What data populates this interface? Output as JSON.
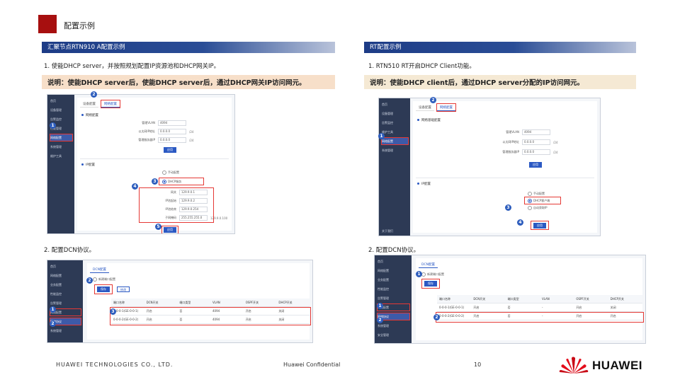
{
  "page": {
    "title": "配置示例",
    "page_number": "10",
    "footer_left": "HUAWEI TECHNOLOGIES CO., LTD.",
    "footer_center": "Huawei Confidential",
    "logo_text": "HUAWEI",
    "brand_color": "#a70f0f"
  },
  "left_panel": {
    "banner": "汇聚节点RTN910 A配置示例",
    "step1": "1. 使能DHCP server，并按照规划配置IP资源池和DHCP网关IP。",
    "note": "说明：使能DHCP server后，使能DHCP server后，通过DHCP网关IP访问网元。",
    "step2": "2. 配置DCN协议。",
    "shot1": {
      "sidebar": [
        "首页",
        "设备管理",
        "告警监控",
        "性能管理",
        "网络配置",
        "系统管理",
        "维护工具"
      ],
      "tabs": [
        "设备配置",
        "网络配置"
      ],
      "sec1": "网络配置",
      "fields": [
        {
          "label": "管理VLAN",
          "value": "4094",
          "unit": ""
        },
        {
          "label": "以太网IP地址",
          "value": "0.0.0.0",
          "unit": "/24"
        },
        {
          "label": "管理服务器IP",
          "value": "0.0.0.0",
          "unit": "/24"
        }
      ],
      "apply": "应用",
      "sec2": "IP配置",
      "radios": [
        "手动配置",
        "DHCP服务"
      ],
      "pool_fields": [
        {
          "label": "网关",
          "value": "129.9.0.1"
        },
        {
          "label": "IP池起始",
          "value": "129.9.0.2"
        },
        {
          "label": "IP池结束",
          "value": "129.9.0.254"
        },
        {
          "label": "子网掩码",
          "value": "255.255.255.0"
        }
      ],
      "range": "129.9.0.100",
      "save": "应用"
    },
    "shot2": {
      "sidebar": [
        "首页",
        "网络配置",
        "业务配置",
        "性能监控",
        "告警管理",
        "网络配置",
        "网络协议",
        "系统管理"
      ],
      "tab": "DCN配置",
      "toolbar": "新建端口配置",
      "btn1": "保存",
      "btn2": "修改",
      "columns": [
        "端口名称",
        "DCN开关",
        "端口类型",
        "VLAN",
        "OSPF开关",
        "DHCP开关"
      ],
      "rows": [
        [
          "0-0-0-1(GE-0-0-1)",
          "开启",
          "否",
          "4094",
          "开启",
          "关闭"
        ],
        [
          "0-0-0-2(GE-0-0-2)",
          "开启",
          "否",
          "4094",
          "开启",
          "关闭"
        ]
      ]
    }
  },
  "right_panel": {
    "banner": "RT配置示例",
    "step1": "1. RTN510 RT开启DHCP Client功能。",
    "note": "说明：使能DHCP client后，通过DHCP server分配的IP访问网元。",
    "step2": "2. 配置DCN协议。",
    "shot1": {
      "sidebar": [
        "首页",
        "设备管理",
        "告警监控",
        "维护工具",
        "网络配置",
        "系统管理"
      ],
      "bottom_item": "关于我们",
      "tabs": [
        "设备配置",
        "网络配置"
      ],
      "sec1": "网络基础配置",
      "fields": [
        {
          "label": "管理VLAN",
          "value": "4094",
          "unit": ""
        },
        {
          "label": "以太网IP地址",
          "value": "0.0.0.0",
          "unit": "/24"
        },
        {
          "label": "管理服务器IP",
          "value": "0.0.0.0",
          "unit": "/24"
        }
      ],
      "apply": "应用",
      "sec2": "IP配置",
      "radios": [
        "手动配置",
        "DHCP客户端",
        "自动获取IP"
      ],
      "save": "应用"
    },
    "shot2": {
      "sidebar": [
        "首页",
        "网络配置",
        "业务配置",
        "性能监控",
        "告警管理",
        "网络配置",
        "网络协议",
        "系统管理",
        "安全管理"
      ],
      "tab": "DCN配置",
      "toolbar": "新建端口配置",
      "btn1": "保存",
      "columns": [
        "端口名称",
        "DCN开关",
        "端口类型",
        "VLAN",
        "OSPF开关",
        "DHCP开关"
      ],
      "rows": [
        [
          "0-0-0-1(GE-0-0-1)",
          "开启",
          "否",
          "-",
          "开启",
          "关闭"
        ],
        [
          "0-0-0-2(GE-0-0-2)",
          "开启",
          "否",
          "-",
          "开启",
          "开启"
        ]
      ]
    }
  },
  "markers": [
    "1",
    "2",
    "3",
    "4",
    "5"
  ]
}
